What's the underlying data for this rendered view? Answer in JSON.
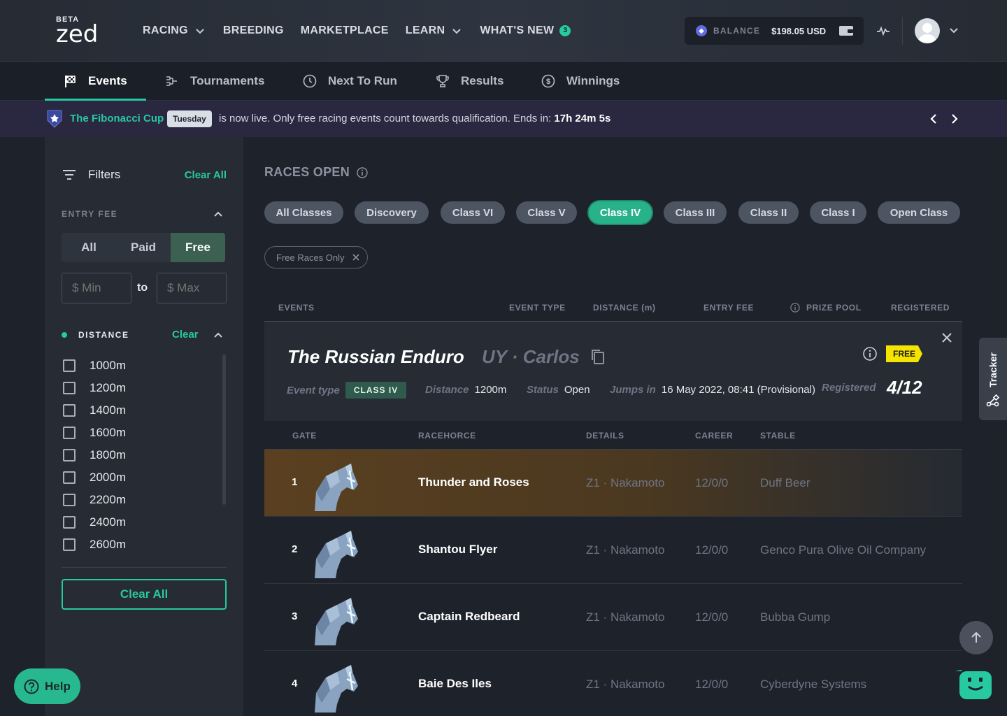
{
  "brand": {
    "beta": "BETA",
    "logo": "zed"
  },
  "mainnav": [
    {
      "label": "RACING",
      "dropdown": true
    },
    {
      "label": "BREEDING",
      "dropdown": false
    },
    {
      "label": "MARKETPLACE",
      "dropdown": false
    },
    {
      "label": "LEARN",
      "dropdown": true
    },
    {
      "label": "WHAT'S NEW",
      "dropdown": false,
      "badge": "3"
    }
  ],
  "balance": {
    "label": "BALANCE",
    "amount": "$198.05 USD"
  },
  "subnav": [
    "Events",
    "Tournaments",
    "Next To Run",
    "Results",
    "Winnings"
  ],
  "banner": {
    "cup": "The Fibonacci Cup",
    "day": "Tuesday",
    "message": "is now live. Only free racing events count towards qualification. Ends in:",
    "countdown": "17h 24m 5s"
  },
  "filters": {
    "title": "Filters",
    "clear_all": "Clear All",
    "entry_fee_label": "ENTRY FEE",
    "entry_fee_options": [
      "All",
      "Paid",
      "Free"
    ],
    "entry_fee_selected": "Free",
    "min_placeholder": "$ Min",
    "max_placeholder": "$ Max",
    "to": "to",
    "distance_label": "DISTANCE",
    "distance_clear": "Clear",
    "distances": [
      "1000m",
      "1200m",
      "1400m",
      "1600m",
      "1800m",
      "2000m",
      "2200m",
      "2400m",
      "2600m"
    ],
    "clear_all_button": "Clear All"
  },
  "races": {
    "title": "RACES OPEN",
    "classes": [
      "All Classes",
      "Discovery",
      "Class VI",
      "Class V",
      "Class IV",
      "Class III",
      "Class II",
      "Class I",
      "Open Class"
    ],
    "selected_class": "Class IV",
    "active_chip": "Free Races Only",
    "columns": [
      "EVENTS",
      "EVENT TYPE",
      "DISTANCE (m)",
      "ENTRY FEE",
      "PRIZE POOL",
      "REGISTERED"
    ]
  },
  "event": {
    "name": "The Russian Enduro",
    "location": "UY · Carlos",
    "badge": "FREE",
    "event_type_label": "Event type",
    "event_type": "CLASS IV",
    "distance_label": "Distance",
    "distance": "1200m",
    "status_label": "Status",
    "status": "Open",
    "jumps_label": "Jumps in",
    "jumps": "16 May 2022, 08:41 (Provisional)",
    "registered_label": "Registered",
    "registered": "4/12"
  },
  "runner_columns": [
    "GATE",
    "RACEHORCE",
    "DETAILS",
    "CAREER",
    "STABLE"
  ],
  "runners": [
    {
      "gate": "1",
      "name": "Thunder and Roses",
      "details": "Z1 · Nakamoto",
      "career": "12/0/0",
      "stable": "Duff Beer"
    },
    {
      "gate": "2",
      "name": "Shantou Flyer",
      "details": "Z1 · Nakamoto",
      "career": "12/0/0",
      "stable": "Genco Pura Olive Oil Company"
    },
    {
      "gate": "3",
      "name": "Captain Redbeard",
      "details": "Z1 · Nakamoto",
      "career": "12/0/0",
      "stable": "Bubba Gump"
    },
    {
      "gate": "4",
      "name": "Baie Des Iles",
      "details": "Z1 · Nakamoto",
      "career": "12/0/0",
      "stable": "Cyberdyne Systems"
    }
  ],
  "tracker": "Tracker",
  "help": "Help",
  "colors": {
    "accent": "#27c9a0",
    "highlight_row": "#5a4020",
    "free_badge": "#f5e400"
  }
}
